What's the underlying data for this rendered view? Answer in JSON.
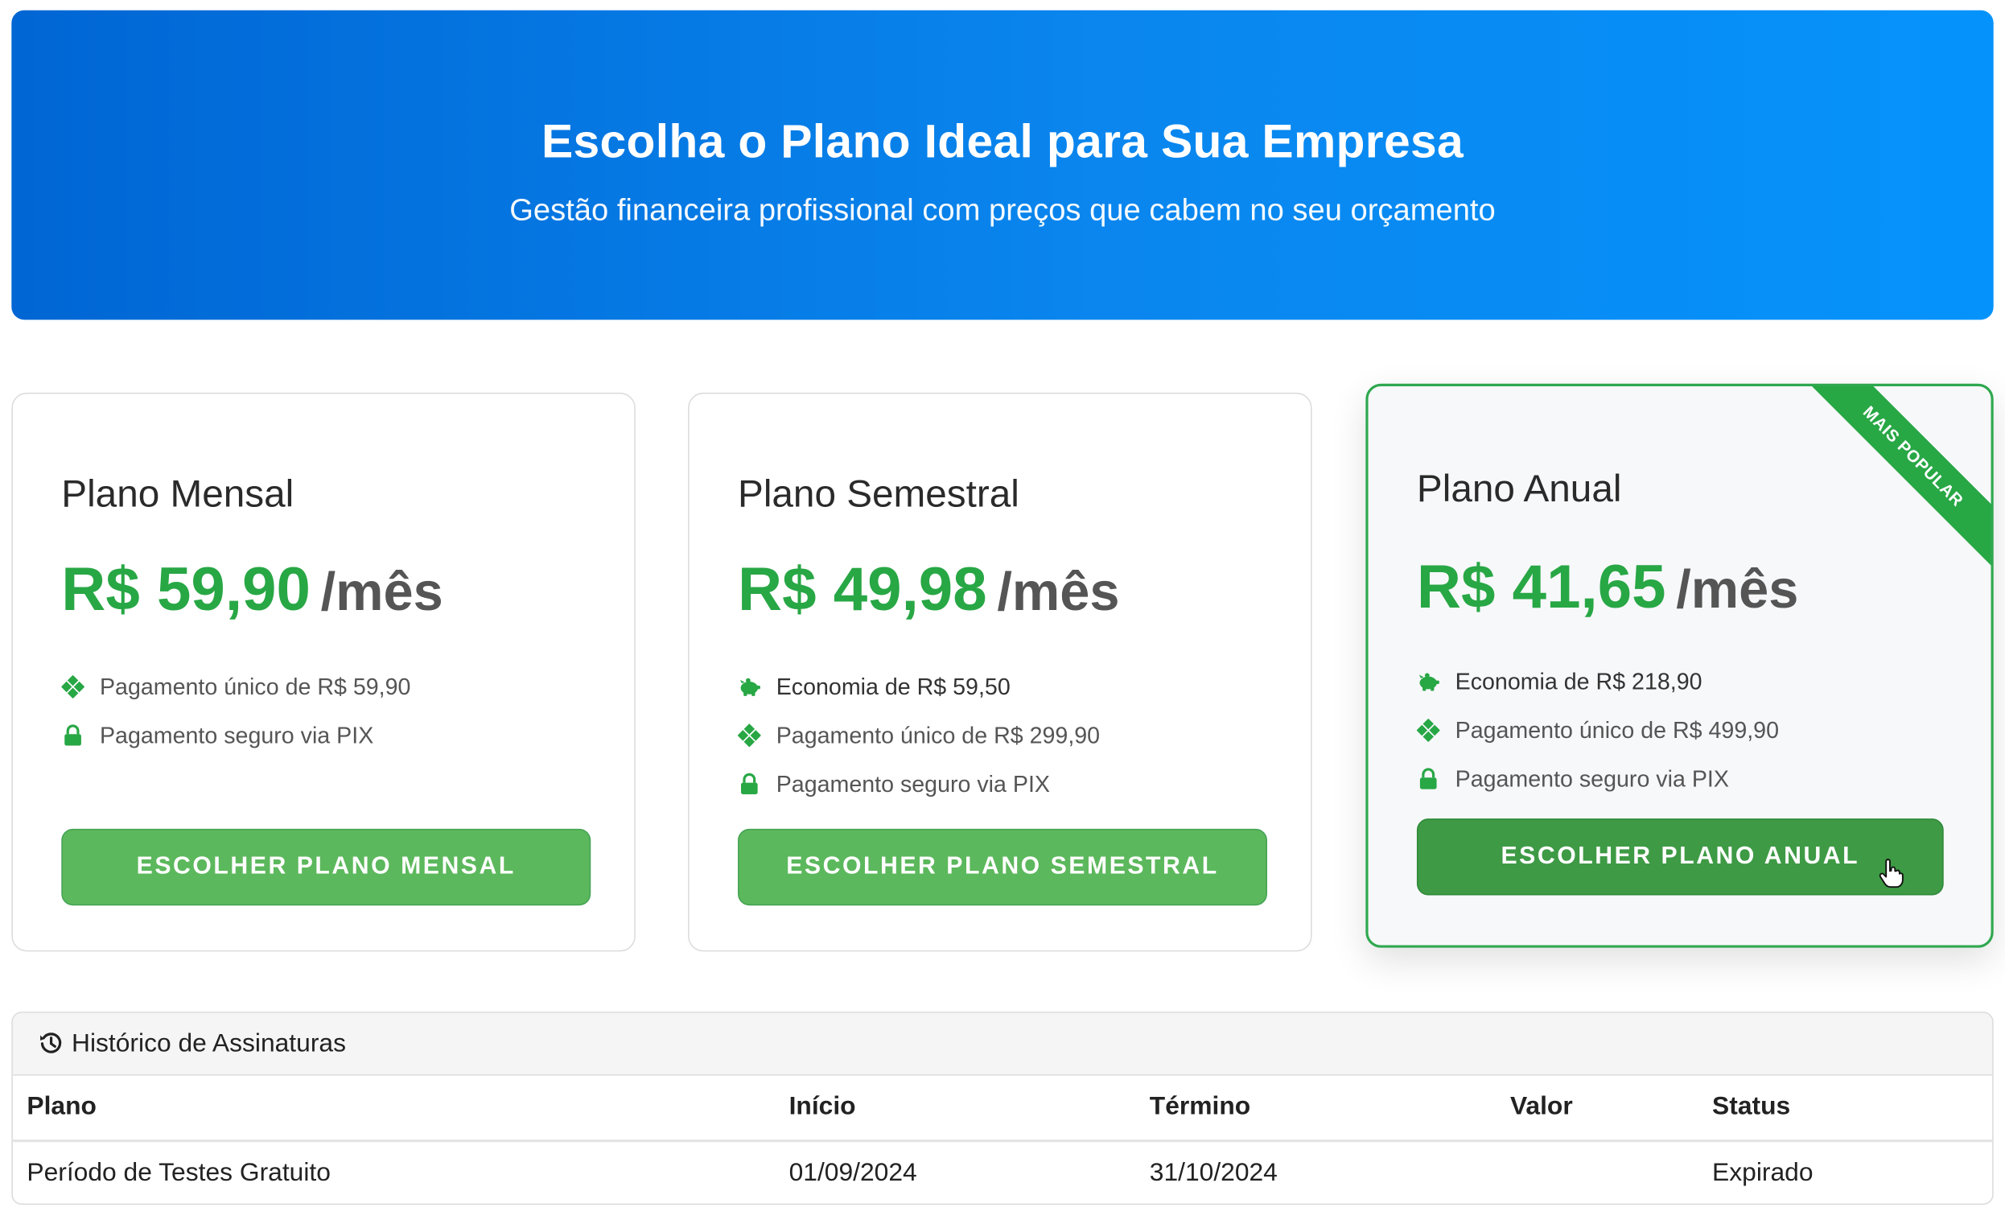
{
  "hero": {
    "title": "Escolha o Plano Ideal para Sua Empresa",
    "subtitle": "Gestão financeira profissional com preços que cabem no seu orçamento"
  },
  "plans": [
    {
      "name": "Plano Mensal",
      "price": "R$ 59,90",
      "period": "/mês",
      "features": [
        {
          "icon": "clover-icon",
          "text": "Pagamento único de R$ 59,90"
        },
        {
          "icon": "lock-icon",
          "text": "Pagamento seguro via PIX"
        }
      ],
      "button": "ESCOLHER PLANO MENSAL"
    },
    {
      "name": "Plano Semestral",
      "price": "R$ 49,98",
      "period": "/mês",
      "features": [
        {
          "icon": "piggy-bank-icon",
          "text": "Economia de R$ 59,50"
        },
        {
          "icon": "clover-icon",
          "text": "Pagamento único de R$ 299,90"
        },
        {
          "icon": "lock-icon",
          "text": "Pagamento seguro via PIX"
        }
      ],
      "button": "ESCOLHER PLANO SEMESTRAL"
    },
    {
      "name": "Plano Anual",
      "price": "R$ 41,65",
      "period": "/mês",
      "badge": "MAIS POPULAR",
      "features": [
        {
          "icon": "piggy-bank-icon",
          "text": "Economia de R$ 218,90"
        },
        {
          "icon": "clover-icon",
          "text": "Pagamento único de R$ 499,90"
        },
        {
          "icon": "lock-icon",
          "text": "Pagamento seguro via PIX"
        }
      ],
      "button": "ESCOLHER PLANO ANUAL"
    }
  ],
  "history": {
    "title": "Histórico de Assinaturas",
    "icon": "history-icon",
    "columns": [
      "Plano",
      "Início",
      "Término",
      "Valor",
      "Status"
    ],
    "rows": [
      [
        "Período de Testes Gratuito",
        "01/09/2024",
        "31/10/2024",
        "",
        "Expirado"
      ]
    ]
  },
  "colors": {
    "hero_gradient_start": "#0066d4",
    "hero_gradient_end": "#0593fb",
    "price_green": "#28a745",
    "button_green": "#5cb85c",
    "button_green_active": "#3e9a45"
  }
}
